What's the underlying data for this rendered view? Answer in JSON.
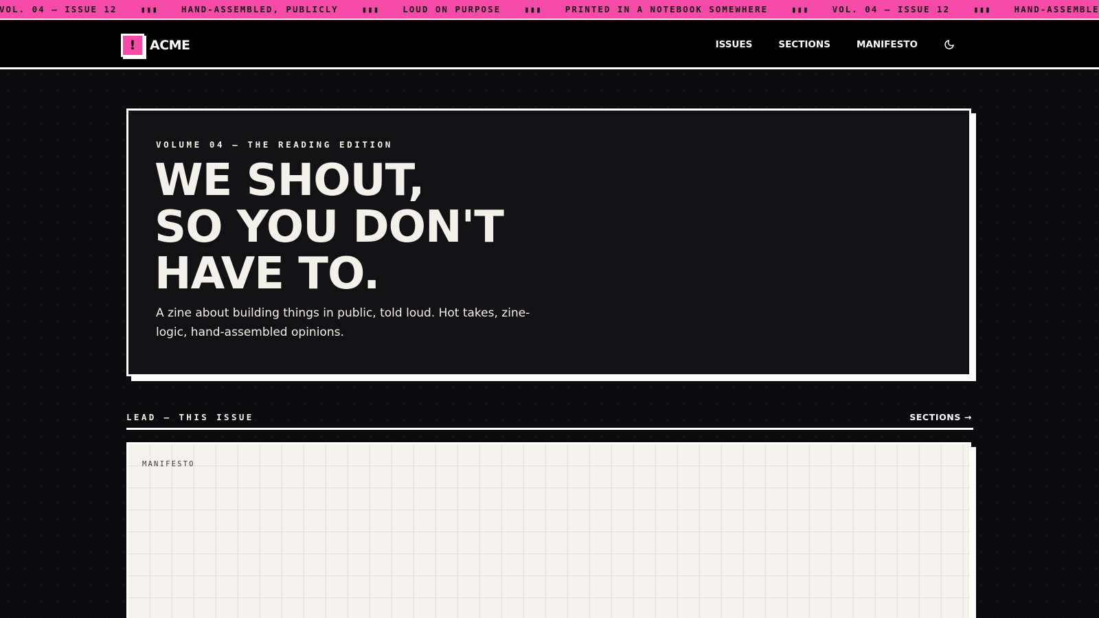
{
  "ticker": {
    "items": [
      "VOL. 04 — ISSUE 12",
      "HAND-ASSEMBLED, PUBLICLY",
      "LOUD ON PURPOSE",
      "PRINTED IN A NOTEBOOK SOMEWHERE",
      "VOL. 04 — ISSUE 12",
      "HAND-ASSEMBLED, PUBLICLY"
    ],
    "separator": "▮▮▮"
  },
  "header": {
    "logo_mark": "!",
    "logo_text": "ACME",
    "nav": [
      "ISSUES",
      "SECTIONS",
      "MANIFESTO"
    ],
    "theme_icon": "moon-icon"
  },
  "hero": {
    "kicker": "VOLUME 04 — THE READING EDITION",
    "title_lines": [
      "WE SHOUT,",
      "SO YOU DON'T",
      "HAVE TO."
    ],
    "subtitle": "A zine about building things in public, told loud. Hot takes, zine-logic, hand-assembled opinions."
  },
  "lead_section": {
    "label": "LEAD — THIS ISSUE",
    "link": "SECTIONS →"
  },
  "lead_card": {
    "tag": "MANIFESTO"
  },
  "colors": {
    "accent": "#f54aa8",
    "background": "#0b0b0d",
    "paper": "#f4f2ec",
    "ink": "#f3f1ea"
  }
}
